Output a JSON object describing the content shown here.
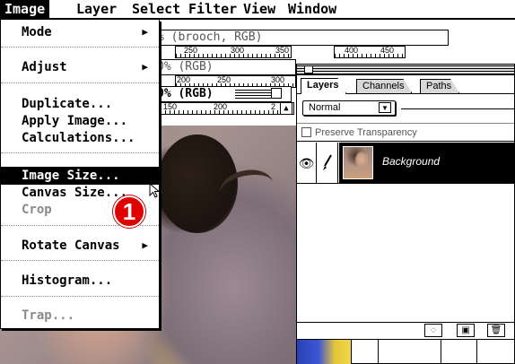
{
  "menubar": {
    "items": [
      "Image",
      "Layer",
      "Select",
      "Filter",
      "View",
      "Window"
    ],
    "active": "Image"
  },
  "windows": {
    "title1": "% (brooch, RGB)",
    "title2": "0% (RGB)",
    "title3": "0% (RGB)",
    "ruler1": [
      "250",
      "300",
      "350",
      "400",
      "450"
    ],
    "ruler2": [
      "200",
      "250",
      "300"
    ],
    "ruler3": [
      "150",
      "200",
      "2"
    ]
  },
  "image_menu": {
    "items": [
      {
        "label": "Mode",
        "submenu": true,
        "enabled": true
      },
      {
        "label": "Adjust",
        "submenu": true,
        "enabled": true
      },
      {
        "label": "Duplicate...",
        "submenu": false,
        "enabled": true
      },
      {
        "label": "Apply Image...",
        "submenu": false,
        "enabled": true
      },
      {
        "label": "Calculations...",
        "submenu": false,
        "enabled": true
      },
      {
        "label": "Image Size...",
        "submenu": false,
        "enabled": true,
        "highlighted": true
      },
      {
        "label": "Canvas Size...",
        "submenu": false,
        "enabled": true
      },
      {
        "label": "Crop",
        "submenu": false,
        "enabled": false
      },
      {
        "label": "Rotate Canvas",
        "submenu": true,
        "enabled": true
      },
      {
        "label": "Histogram...",
        "submenu": false,
        "enabled": true
      },
      {
        "label": "Trap...",
        "submenu": false,
        "enabled": false
      }
    ]
  },
  "step_badge": "1",
  "layers_palette": {
    "tabs": [
      "Layers",
      "Channels",
      "Paths"
    ],
    "active_tab": "Layers",
    "blend_mode": "Normal",
    "preserve_transparency": "Preserve Transparency",
    "layers": [
      {
        "name": "Background",
        "visible": true,
        "selected": true
      }
    ]
  },
  "colors": {
    "menu_highlight": "#000000",
    "badge": "#e10000",
    "selected_layer": "#000000"
  }
}
